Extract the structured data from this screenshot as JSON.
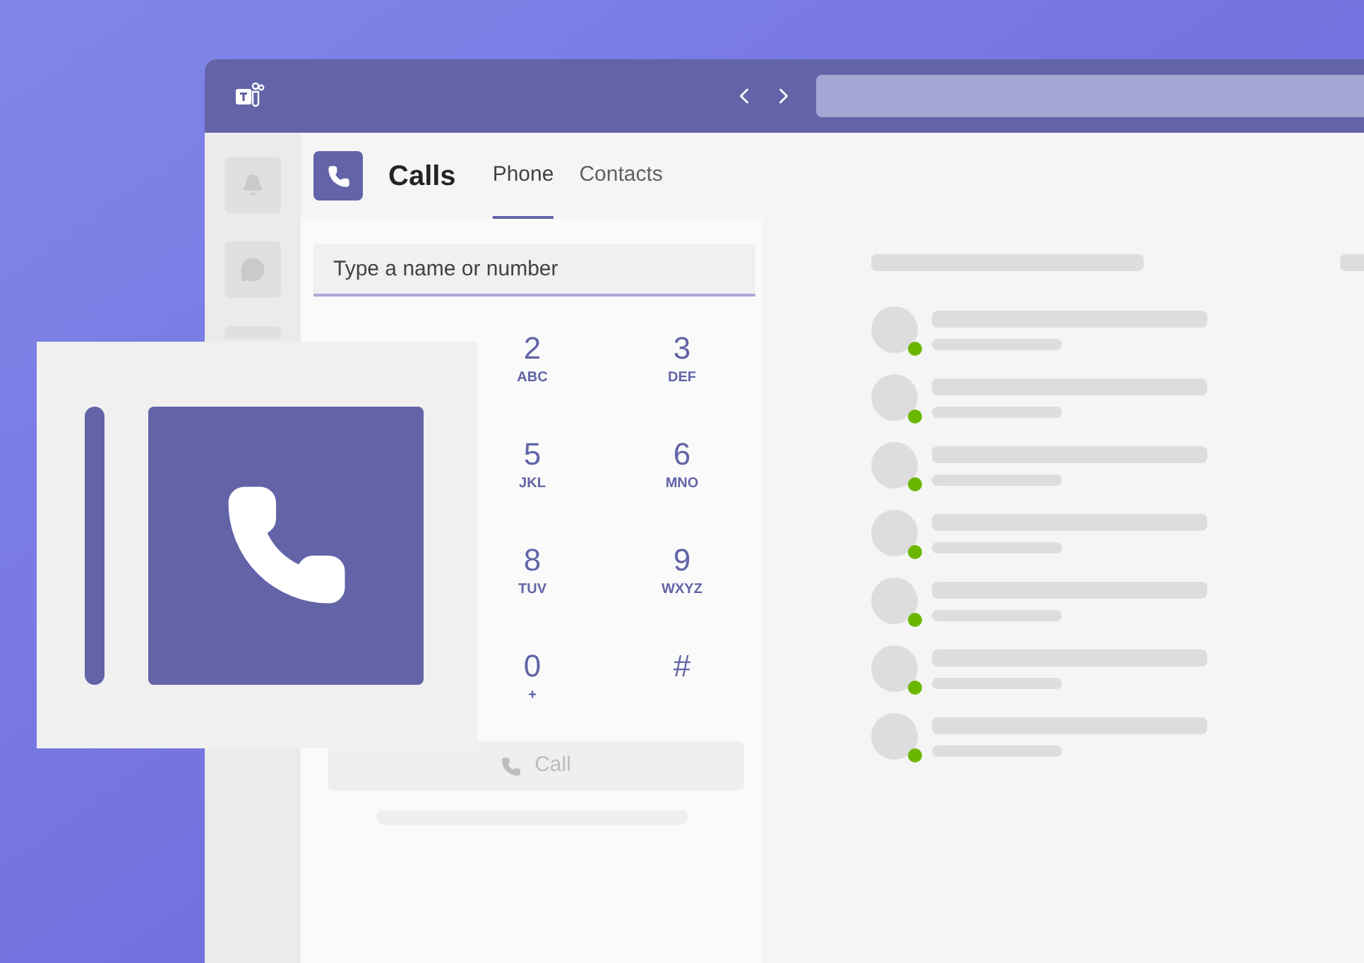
{
  "app": {
    "title": "Calls"
  },
  "tabs": [
    {
      "label": "Phone",
      "selected": true
    },
    {
      "label": "Contacts",
      "selected": false
    }
  ],
  "dial_search": {
    "placeholder": "Type a name or number"
  },
  "keypad": [
    {
      "digit": "2",
      "letters": "ABC"
    },
    {
      "digit": "3",
      "letters": "DEF"
    },
    {
      "digit": "5",
      "letters": "JKL"
    },
    {
      "digit": "6",
      "letters": "MNO"
    },
    {
      "digit": "8",
      "letters": "TUV"
    },
    {
      "digit": "9",
      "letters": "WXYZ"
    },
    {
      "digit": "0",
      "letters": "+"
    },
    {
      "digit": "#"
    }
  ],
  "call_button": {
    "label": "Call",
    "disabled": true
  },
  "contacts": [
    {
      "online": true
    },
    {
      "online": true
    },
    {
      "online": true
    },
    {
      "online": true
    },
    {
      "online": true
    },
    {
      "online": true
    },
    {
      "online": true
    }
  ]
}
